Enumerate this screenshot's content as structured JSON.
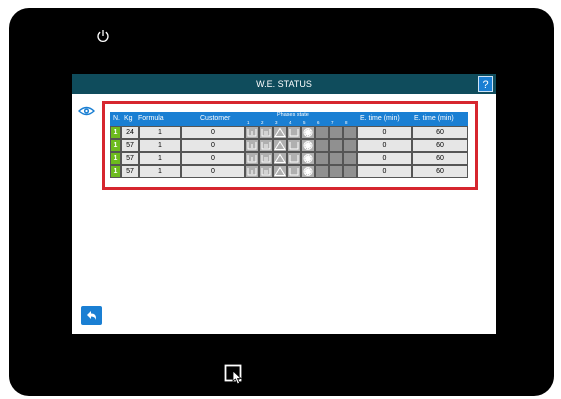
{
  "window": {
    "title": "W.E. STATUS",
    "help_label": "?"
  },
  "table": {
    "headers": {
      "n": "N.",
      "kg": "Kg",
      "formula": "Formula",
      "customer": "Customer",
      "phases_state": "Phases state",
      "phase_numbers": [
        "1",
        "2",
        "3",
        "4",
        "5",
        "6",
        "7",
        "8"
      ],
      "etime1": "E. time (min)",
      "etime2": "E. time (min)"
    },
    "rows": [
      {
        "n": "1",
        "kg": "24",
        "formula": "1",
        "customer": "0",
        "etime1": "0",
        "etime2": "60"
      },
      {
        "n": "1",
        "kg": "57",
        "formula": "1",
        "customer": "0",
        "etime1": "0",
        "etime2": "60"
      },
      {
        "n": "1",
        "kg": "57",
        "formula": "1",
        "customer": "0",
        "etime1": "0",
        "etime2": "60"
      },
      {
        "n": "1",
        "kg": "57",
        "formula": "1",
        "customer": "0",
        "etime1": "0",
        "etime2": "60"
      }
    ]
  },
  "icons": {
    "power": "power-icon",
    "eye": "eye-icon",
    "back": "back-arrow-icon",
    "touch": "touch-screen-icon",
    "phases": [
      "prewash-tub-icon",
      "wash-tub-icon",
      "bleach-triangle-icon",
      "rinse-tub-icon",
      "spin-drum-icon"
    ]
  },
  "colors": {
    "accent": "#1a7fd3",
    "titlebar": "#0f4c5c",
    "highlight": "#d6262f",
    "row_number": "#6dbb1e"
  }
}
